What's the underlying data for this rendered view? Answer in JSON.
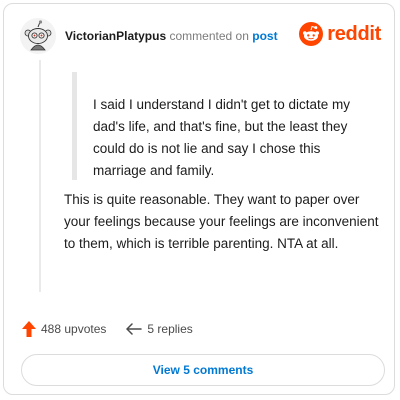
{
  "comment": {
    "username": "VictorianPlatypus",
    "action_text": "commented on",
    "post_link": "post",
    "quote": "I said I understand I didn't get to dictate my dad's life, and that's fine, but the least they could do is not lie and say I chose this marriage and family.",
    "body": "This is quite reasonable. They want to paper over your feelings because your feelings are inconvenient to them, which is terrible parenting. NTA at all.",
    "upvotes": "488 upvotes",
    "replies": "5 replies"
  },
  "brand": {
    "wordmark": "reddit",
    "color": "#ff4500"
  },
  "view_button_label": "View 5 comments",
  "colors": {
    "link": "#0079d3",
    "upvote": "#ff4500",
    "text": "#1c1c1c",
    "muted": "#7c7c7c"
  },
  "icons": {
    "avatar": "snoo-avatar-icon",
    "upvote": "upvote-arrow-icon",
    "reply": "reply-arrow-icon",
    "logo": "reddit-snoo-icon"
  }
}
